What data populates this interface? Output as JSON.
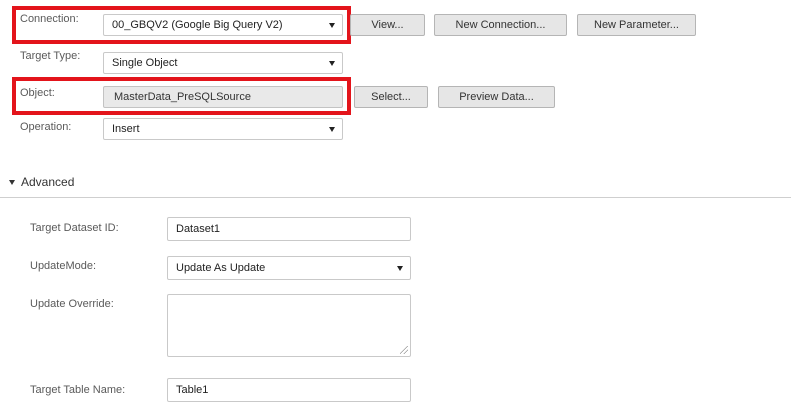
{
  "connection": {
    "label": "Connection:",
    "value": "00_GBQV2 (Google Big Query V2)",
    "view_button": "View...",
    "new_connection_button": "New Connection...",
    "new_parameter_button": "New Parameter..."
  },
  "target_type": {
    "label": "Target Type:",
    "value": "Single Object"
  },
  "object": {
    "label": "Object:",
    "value": "MasterData_PreSQLSource",
    "select_button": "Select...",
    "preview_button": "Preview Data..."
  },
  "operation": {
    "label": "Operation:",
    "value": "Insert"
  },
  "advanced": {
    "title": "Advanced",
    "target_dataset_id": {
      "label": "Target Dataset ID:",
      "value": "Dataset1"
    },
    "update_mode": {
      "label": "UpdateMode:",
      "value": "Update As Update"
    },
    "update_override": {
      "label": "Update Override:",
      "value": ""
    },
    "target_table_name": {
      "label": "Target Table Name:",
      "value": "Table1"
    }
  },
  "colors": {
    "highlight": "#e3141b",
    "field_border": "#c9c9c9",
    "button_bg": "#e6e6e6",
    "readonly_bg": "#e9e9e9"
  }
}
